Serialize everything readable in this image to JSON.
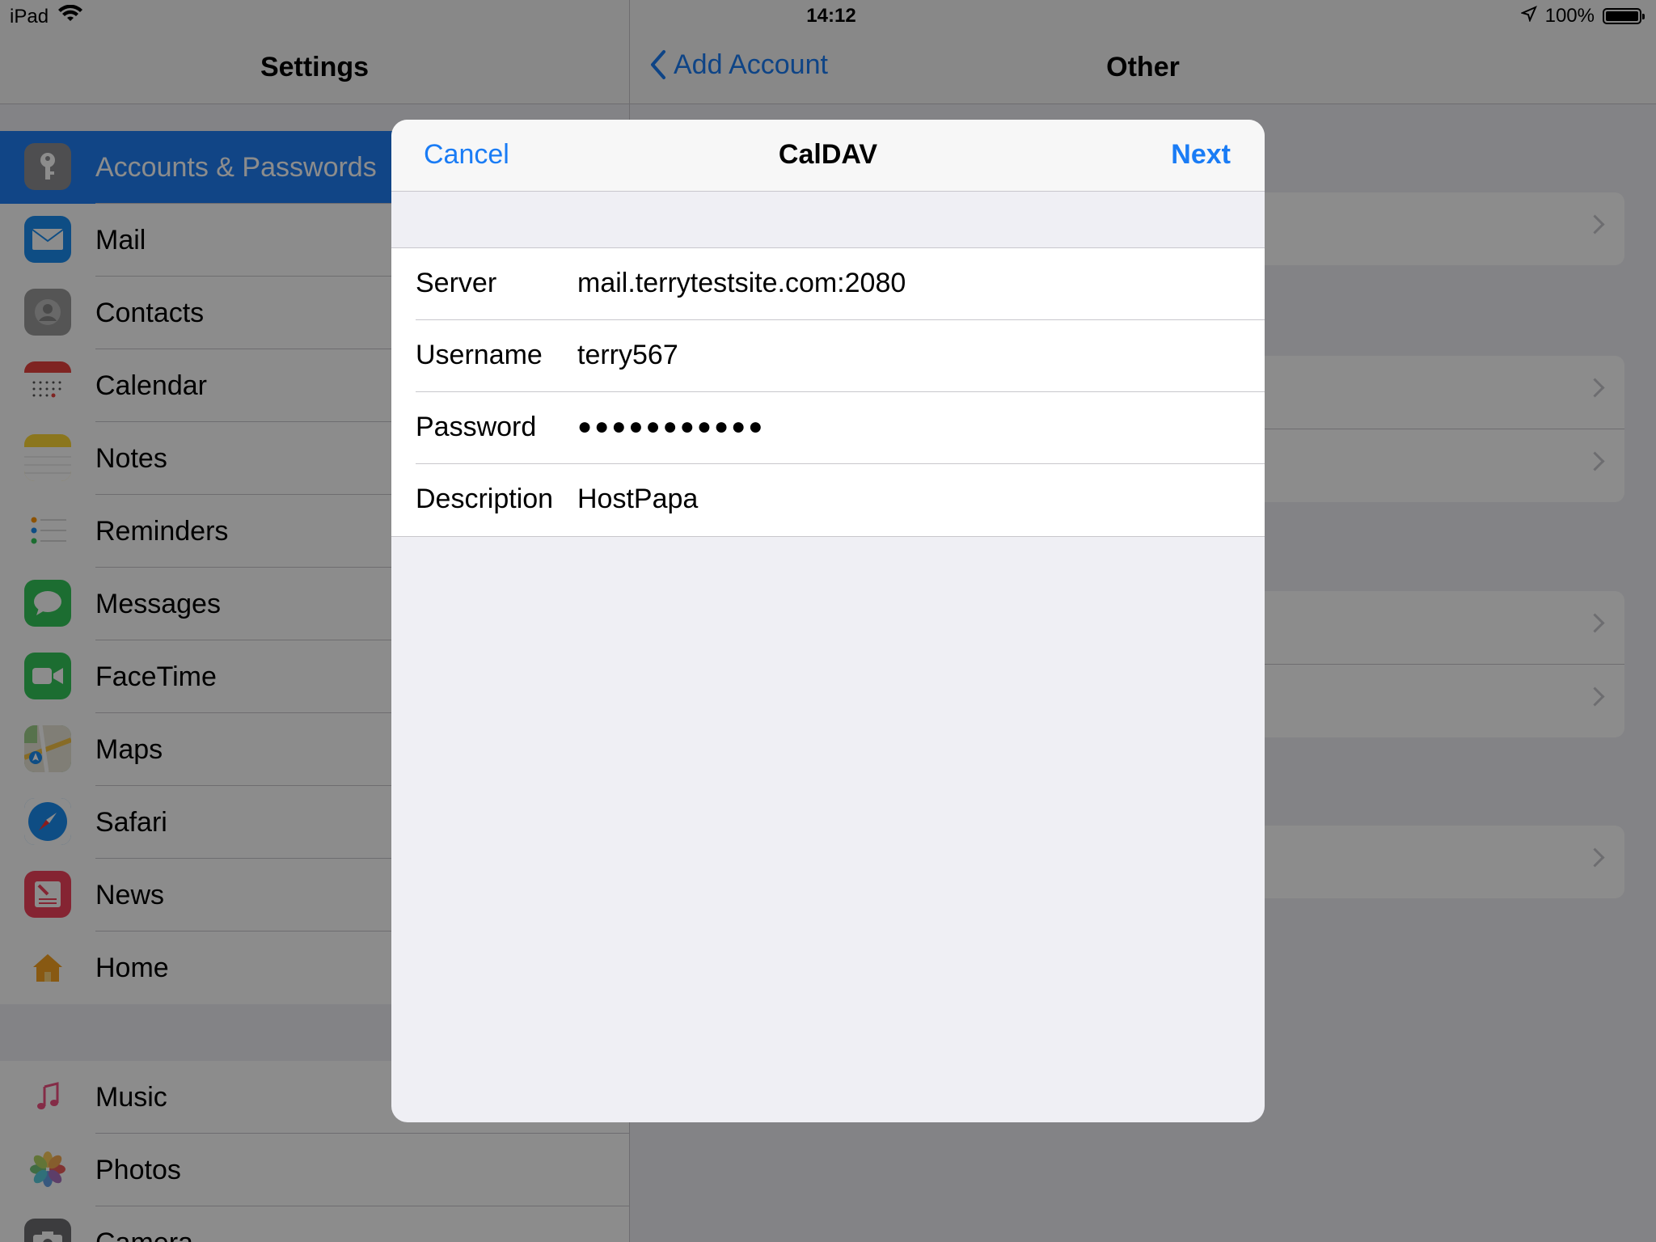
{
  "status_bar": {
    "device": "iPad",
    "time": "14:12",
    "battery": "100%",
    "battery_level": 1.0
  },
  "settings": {
    "title": "Settings",
    "group1": [
      {
        "label": "Accounts & Passwords",
        "icon": "key-icon",
        "color": "#8e8e93",
        "selected": true
      },
      {
        "label": "Mail",
        "icon": "mail-icon",
        "color": "#1a8cf0"
      },
      {
        "label": "Contacts",
        "icon": "contacts-icon",
        "color": "#9b9b9b"
      },
      {
        "label": "Calendar",
        "icon": "calendar-icon",
        "color": "#ffffff"
      },
      {
        "label": "Notes",
        "icon": "notes-icon",
        "color": "#fdd835"
      },
      {
        "label": "Reminders",
        "icon": "reminders-icon",
        "color": "#ffffff"
      },
      {
        "label": "Messages",
        "icon": "messages-icon",
        "color": "#34c759"
      },
      {
        "label": "FaceTime",
        "icon": "facetime-icon",
        "color": "#34c759"
      },
      {
        "label": "Maps",
        "icon": "maps-icon",
        "color": "#6fbf73"
      },
      {
        "label": "Safari",
        "icon": "safari-icon",
        "color": "#1a8cf0"
      },
      {
        "label": "News",
        "icon": "news-icon",
        "color": "#f2435b"
      },
      {
        "label": "Home",
        "icon": "home-icon",
        "color": "#ffffff"
      }
    ],
    "group2": [
      {
        "label": "Music",
        "icon": "music-icon",
        "color": "#ffffff"
      },
      {
        "label": "Photos",
        "icon": "photos-icon",
        "color": "#ffffff"
      },
      {
        "label": "Camera",
        "icon": "camera-icon",
        "color": "#6d6d72"
      }
    ]
  },
  "detail": {
    "back_label": "Add Account",
    "title": "Other"
  },
  "modal": {
    "cancel_label": "Cancel",
    "title": "CalDAV",
    "next_label": "Next",
    "fields": [
      {
        "label": "Server",
        "value": "mail.terrytestsite.com:2080"
      },
      {
        "label": "Username",
        "value": "terry567"
      },
      {
        "label": "Password",
        "value": "●●●●●●●●●●●"
      },
      {
        "label": "Description",
        "value": "HostPapa"
      }
    ]
  },
  "colors": {
    "accent": "#1a7cf5",
    "selection": "#1f7ff5"
  }
}
